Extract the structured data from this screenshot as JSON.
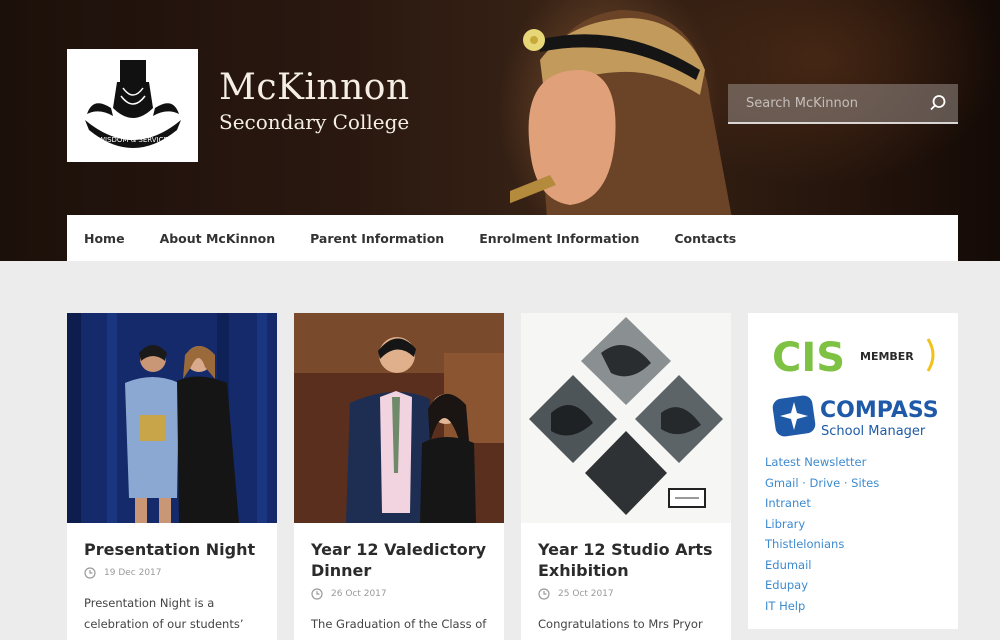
{
  "header": {
    "school_name": "McKinnon",
    "school_subtitle": "Secondary College",
    "logo_motto": "WISDOM & SERVICE",
    "search_placeholder": "Search McKinnon"
  },
  "nav": {
    "items": [
      {
        "label": "Home"
      },
      {
        "label": "About McKinnon"
      },
      {
        "label": "Parent Information"
      },
      {
        "label": "Enrolment Information"
      },
      {
        "label": "Contacts"
      }
    ]
  },
  "posts": [
    {
      "title": "Presentation Night",
      "date": "19 Dec 2017",
      "excerpt": "Presentation Night is a celebration of our students’"
    },
    {
      "title": "Year 12 Valedictory Dinner",
      "date": "26 Oct 2017",
      "excerpt": "The Graduation of the Class of"
    },
    {
      "title": "Year 12 Studio Arts Exhibition",
      "date": "25 Oct 2017",
      "excerpt": "Congratulations to Mrs Pryor"
    }
  ],
  "sidebar": {
    "cis_text": "CIS",
    "cis_member": "MEMBER",
    "compass_title": "COMPASS",
    "compass_sub": "School Manager",
    "links": [
      {
        "label": "Latest Newsletter"
      },
      {
        "label": "Gmail · Drive · Sites"
      },
      {
        "label": "Intranet"
      },
      {
        "label": "Library"
      },
      {
        "label": "Thistlelonians"
      },
      {
        "label": "Edumail"
      },
      {
        "label": "Edupay"
      },
      {
        "label": "IT Help"
      }
    ]
  },
  "colors": {
    "link": "#3d8ad0",
    "page_bg": "#ececec",
    "compass_blue": "#1e5aa8"
  }
}
